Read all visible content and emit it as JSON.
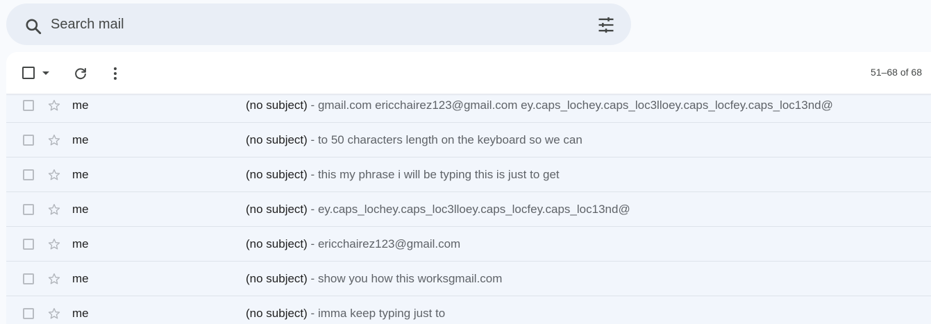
{
  "search": {
    "placeholder": "Search mail"
  },
  "toolbar": {
    "pagination": "51–68 of 68"
  },
  "rows": [
    {
      "sender": "me",
      "subject": "(no subject)",
      "snippet": "gmail.com ericchairez123@gmail.com ey.caps_lochey.caps_loc3lloey.caps_locfey.caps_loc13nd@"
    },
    {
      "sender": "me",
      "subject": "(no subject)",
      "snippet": "to 50 characters length on the keyboard so we can"
    },
    {
      "sender": "me",
      "subject": "(no subject)",
      "snippet": "this my phrase i will be typing this is just to get"
    },
    {
      "sender": "me",
      "subject": "(no subject)",
      "snippet": "ey.caps_lochey.caps_loc3lloey.caps_locfey.caps_loc13nd@"
    },
    {
      "sender": "me",
      "subject": "(no subject)",
      "snippet": "ericchairez123@gmail.com"
    },
    {
      "sender": "me",
      "subject": "(no subject)",
      "snippet": "show you how this worksgmail.com"
    },
    {
      "sender": "me",
      "subject": "(no subject)",
      "snippet": "imma keep typing just to"
    }
  ],
  "separator": " - ",
  "colors": {
    "background": "#f8fafd",
    "search_bg": "#e9eef6",
    "row_bg": "#f2f6fc",
    "text": "#1f1f1f",
    "muted": "#5f6368"
  }
}
